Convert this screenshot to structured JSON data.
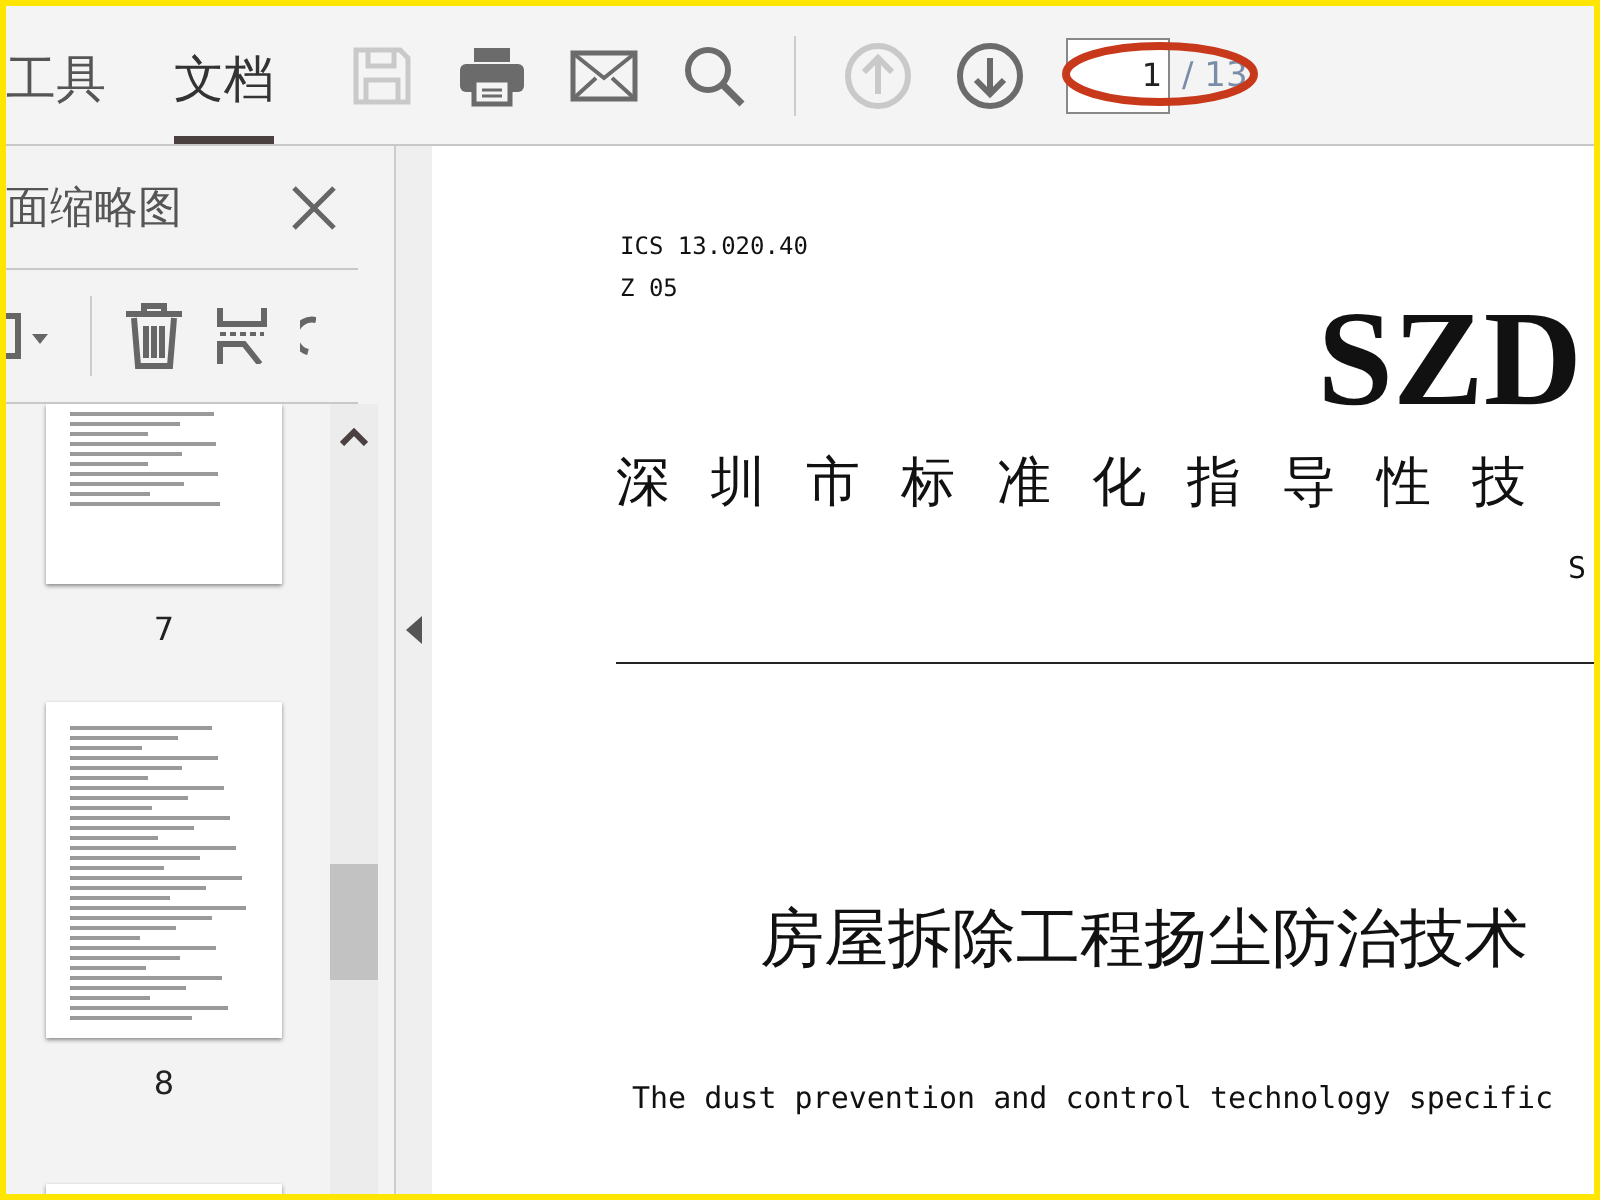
{
  "toolbar": {
    "tabs": [
      {
        "label": "工具",
        "selected": false
      },
      {
        "label": "文档",
        "selected": true
      }
    ],
    "tools": [
      {
        "kind": "save",
        "disabled": true
      },
      {
        "kind": "print",
        "disabled": false
      },
      {
        "kind": "mail",
        "disabled": false
      },
      {
        "kind": "search",
        "disabled": false
      }
    ],
    "nav": [
      {
        "kind": "up",
        "disabled": true
      },
      {
        "kind": "down",
        "disabled": false
      }
    ],
    "page_field": {
      "value": "1",
      "total": "/ 13"
    }
  },
  "sidebar": {
    "title": "面缩略图",
    "thumbnails": [
      {
        "label": "7"
      },
      {
        "label": "8"
      }
    ]
  },
  "document": {
    "ics": "ICS 13.020.40",
    "code": "Z 05",
    "logo": "SZD",
    "org": "深 圳 市 标 准 化 指 导 性 技",
    "series": "S",
    "title_cn": "房屋拆除工程扬尘防治技术",
    "title_en": "The dust prevention and control technology specific"
  }
}
